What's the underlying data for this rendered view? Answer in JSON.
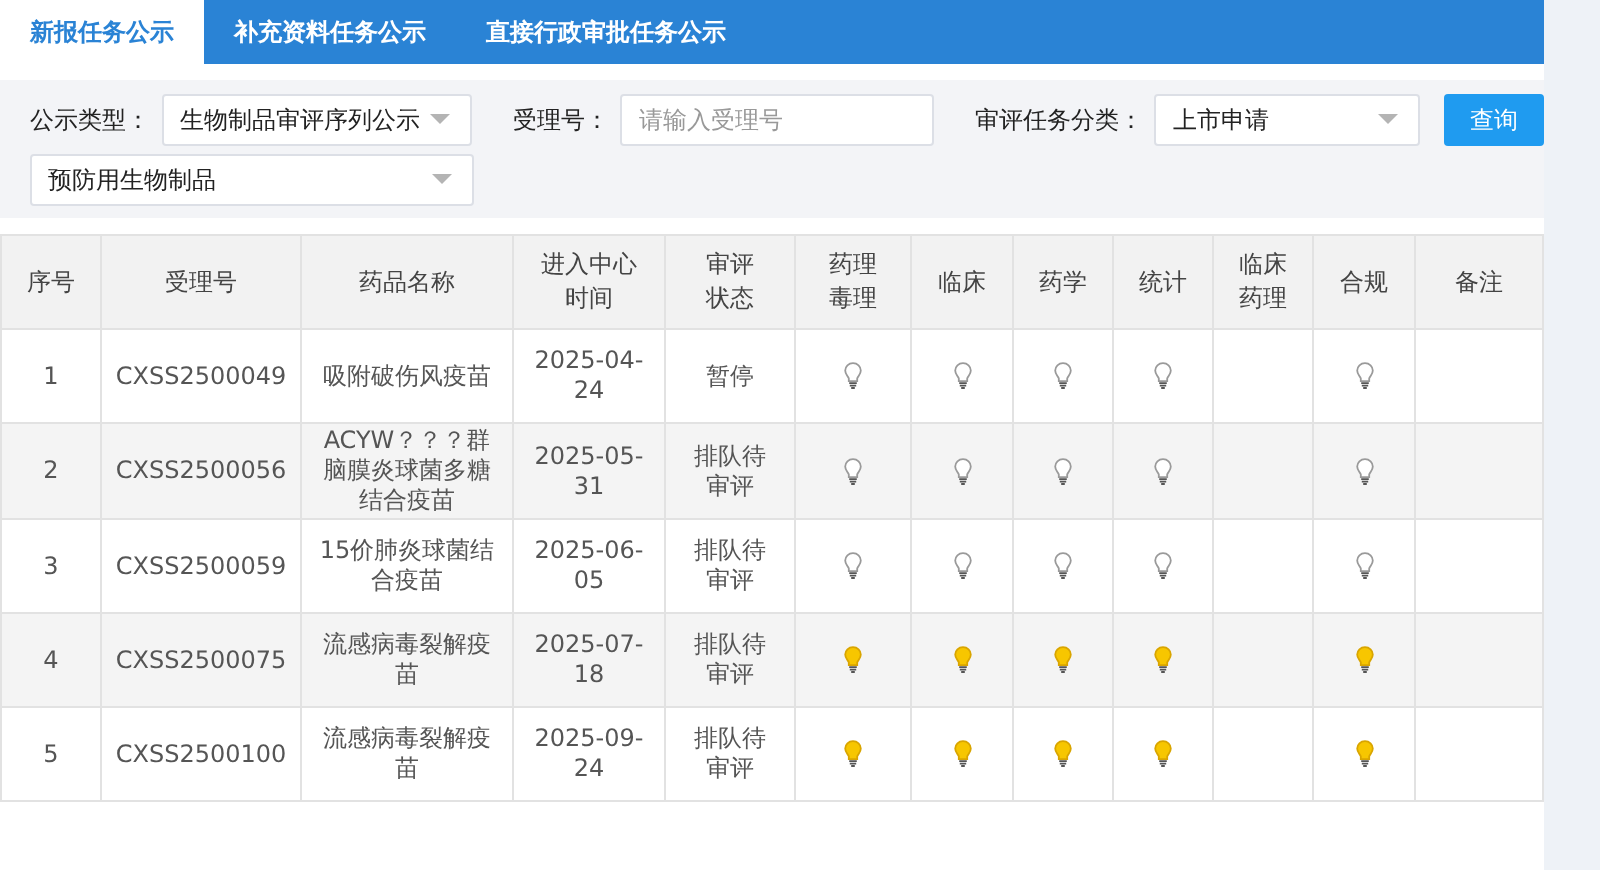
{
  "tabs": [
    {
      "label": "新报任务公示",
      "selected": true
    },
    {
      "label": "补充资料任务公示",
      "selected": false
    },
    {
      "label": "直接行政审批任务公示",
      "selected": false
    }
  ],
  "filters": {
    "category": {
      "label": "公示类型：",
      "value": "生物制品审评序列公示",
      "sub_value": "预防用生物制品"
    },
    "acceptance_no": {
      "label": "受理号：",
      "placeholder": "请输入受理号"
    },
    "task_type": {
      "label": "审评任务分类：",
      "value": "上市申请"
    },
    "query_button": "查询"
  },
  "table": {
    "columns": [
      "序号",
      "受理号",
      "药品名称",
      "进入中心时间",
      "审评状态",
      "药理毒理",
      "临床",
      "药学",
      "统计",
      "临床药理",
      "合规",
      "备注"
    ],
    "rows": [
      {
        "no": "1",
        "acceptance_no": "CXSS2500049",
        "drug_name": "吸附破伤风疫苗",
        "entry_date": "2025-04-24",
        "status": "暂停",
        "lights": [
          {
            "kind": "bulb",
            "on": false
          },
          {
            "kind": "bulb",
            "on": false
          },
          {
            "kind": "bulb",
            "on": false
          },
          {
            "kind": "bulb",
            "on": false
          },
          {
            "kind": "empty"
          },
          {
            "kind": "bulb",
            "on": false
          }
        ]
      },
      {
        "no": "2",
        "acceptance_no": "CXSS2500056",
        "drug_name": "ACYW？？？群脑膜炎球菌多糖结合疫苗",
        "entry_date": "2025-05-31",
        "status": "排队待审评",
        "lights": [
          {
            "kind": "bulb",
            "on": false
          },
          {
            "kind": "bulb",
            "on": false
          },
          {
            "kind": "bulb",
            "on": false
          },
          {
            "kind": "bulb",
            "on": false
          },
          {
            "kind": "empty"
          },
          {
            "kind": "bulb",
            "on": false
          }
        ]
      },
      {
        "no": "3",
        "acceptance_no": "CXSS2500059",
        "drug_name": "15价肺炎球菌结合疫苗",
        "entry_date": "2025-06-05",
        "status": "排队待审评",
        "lights": [
          {
            "kind": "bulb",
            "on": false
          },
          {
            "kind": "bulb",
            "on": false
          },
          {
            "kind": "bulb",
            "on": false
          },
          {
            "kind": "bulb",
            "on": false
          },
          {
            "kind": "empty"
          },
          {
            "kind": "bulb",
            "on": false
          }
        ]
      },
      {
        "no": "4",
        "acceptance_no": "CXSS2500075",
        "drug_name": "流感病毒裂解疫苗",
        "entry_date": "2025-07-18",
        "status": "排队待审评",
        "lights": [
          {
            "kind": "bulb",
            "on": true
          },
          {
            "kind": "bulb",
            "on": true
          },
          {
            "kind": "bulb",
            "on": true
          },
          {
            "kind": "bulb",
            "on": true
          },
          {
            "kind": "empty"
          },
          {
            "kind": "bulb",
            "on": true
          }
        ]
      },
      {
        "no": "5",
        "acceptance_no": "CXSS2500100",
        "drug_name": "流感病毒裂解疫苗",
        "entry_date": "2025-09-24",
        "status": "排队待审评",
        "lights": [
          {
            "kind": "bulb",
            "on": true
          },
          {
            "kind": "bulb",
            "on": true
          },
          {
            "kind": "bulb",
            "on": true
          },
          {
            "kind": "bulb",
            "on": true
          },
          {
            "kind": "empty"
          },
          {
            "kind": "bulb",
            "on": true
          }
        ]
      }
    ]
  }
}
